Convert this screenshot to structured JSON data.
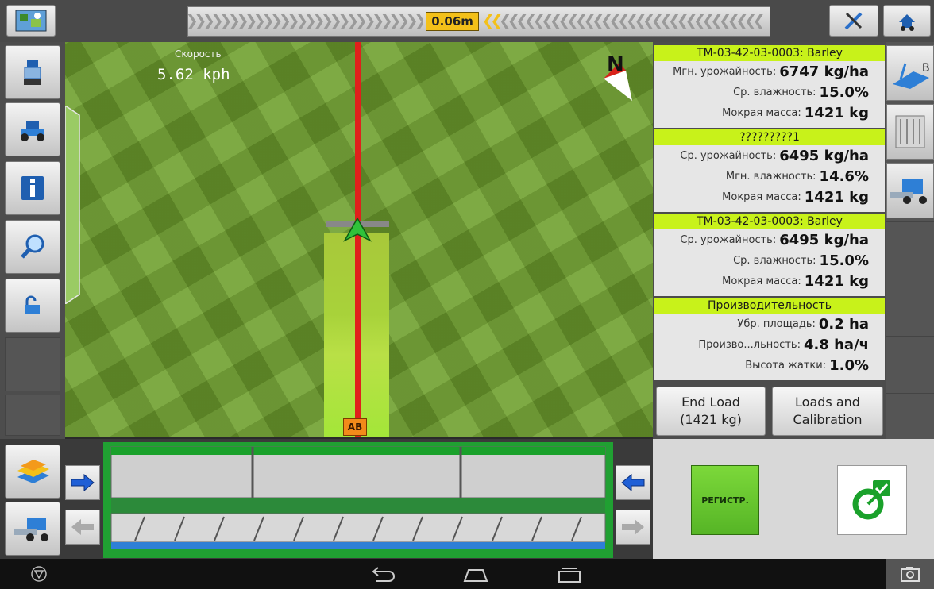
{
  "topbar": {
    "gps_icon": "satellite-map-icon",
    "offset": "0.06m",
    "tools_icon": "tools-icon",
    "home_icon": "tractor-home-icon"
  },
  "left_sidebar": {
    "items": [
      {
        "name": "vehicle-icon"
      },
      {
        "name": "tractor-icon"
      },
      {
        "name": "info-icon"
      },
      {
        "name": "zoom-icon"
      },
      {
        "name": "lock-icon"
      }
    ]
  },
  "map": {
    "speed_label": "Скорость",
    "speed_value": "5.62 kph",
    "compass": "N",
    "ab_badge": "AB"
  },
  "cards": [
    {
      "title": "TM-03-42-03-0003: Barley",
      "rows": [
        {
          "label": "Мгн. урожайность:",
          "value": "6747 kg/ha"
        },
        {
          "label": "Ср. влажность:",
          "value": "15.0%"
        },
        {
          "label": "Мокрая масса:",
          "value": "1421 kg"
        }
      ]
    },
    {
      "title": "?????????1",
      "rows": [
        {
          "label": "Ср. урожайность:",
          "value": "6495 kg/ha"
        },
        {
          "label": "Мгн. влажность:",
          "value": "14.6%"
        },
        {
          "label": "Мокрая масса:",
          "value": "1421 kg"
        }
      ]
    },
    {
      "title": "TM-03-42-03-0003: Barley",
      "rows": [
        {
          "label": "Ср. урожайность:",
          "value": "6495 kg/ha"
        },
        {
          "label": "Ср. влажность:",
          "value": "15.0%"
        },
        {
          "label": "Мокрая масса:",
          "value": "1421 kg"
        }
      ]
    },
    {
      "title": "Производительность",
      "rows": [
        {
          "label": "Убр. площадь:",
          "value": "0.2 ha"
        },
        {
          "label": "Произво...льность:",
          "value": "4.8 ha/ч"
        },
        {
          "label": "Высота жатки:",
          "value": "1.0%"
        }
      ]
    }
  ],
  "actions": {
    "end_load_line1": "End Load",
    "end_load_line2": "(1421 kg)",
    "loads_line1": "Loads and",
    "loads_line2": "Calibration"
  },
  "right_sidebar": {
    "items": [
      {
        "name": "ab-line-icon",
        "text": "B"
      },
      {
        "name": "grain-tank-icon"
      },
      {
        "name": "combine-icon"
      }
    ]
  },
  "bottom": {
    "register_label": "РЕГИСТР."
  },
  "colors": {
    "accent_yellow": "#f3c019",
    "card_header_green": "#c8f21a",
    "guide_red": "#e0201b",
    "coverage_green": "#a4e639",
    "header_green": "#20a032"
  }
}
